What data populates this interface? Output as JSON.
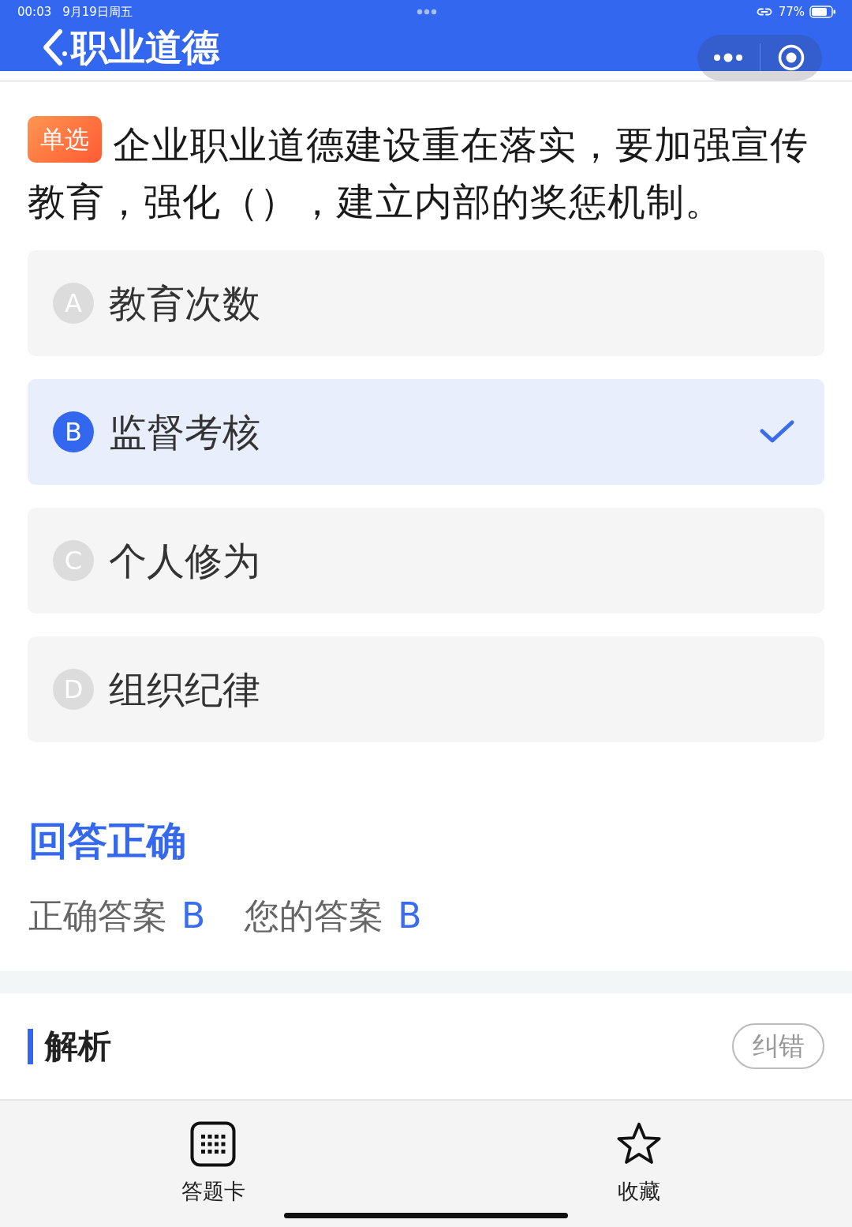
{
  "status_bar": {
    "time": "00:03",
    "date": "9月19日周五",
    "battery": "77%"
  },
  "nav": {
    "title": "职业道德"
  },
  "question": {
    "type_tag": "单选",
    "text_lines": [
      "企业职业道德建设重在落实，要加强宣传",
      "教育，强化（），建立内部的奖惩机制。"
    ]
  },
  "options": [
    {
      "letter": "A",
      "text": "教育次数",
      "selected": false
    },
    {
      "letter": "B",
      "text": "监督考核",
      "selected": true
    },
    {
      "letter": "C",
      "text": "个人修为",
      "selected": false
    },
    {
      "letter": "D",
      "text": "组织纪律",
      "selected": false
    }
  ],
  "result": {
    "title": "回答正确",
    "correct_label": "正确答案",
    "correct_answer": "B",
    "your_label": "您的答案",
    "your_answer": "B"
  },
  "analysis": {
    "title": "解析",
    "report_button": "纠错"
  },
  "tab_bar": [
    {
      "kind": "grid",
      "label": "答题卡"
    },
    {
      "kind": "star",
      "label": "收藏"
    }
  ]
}
